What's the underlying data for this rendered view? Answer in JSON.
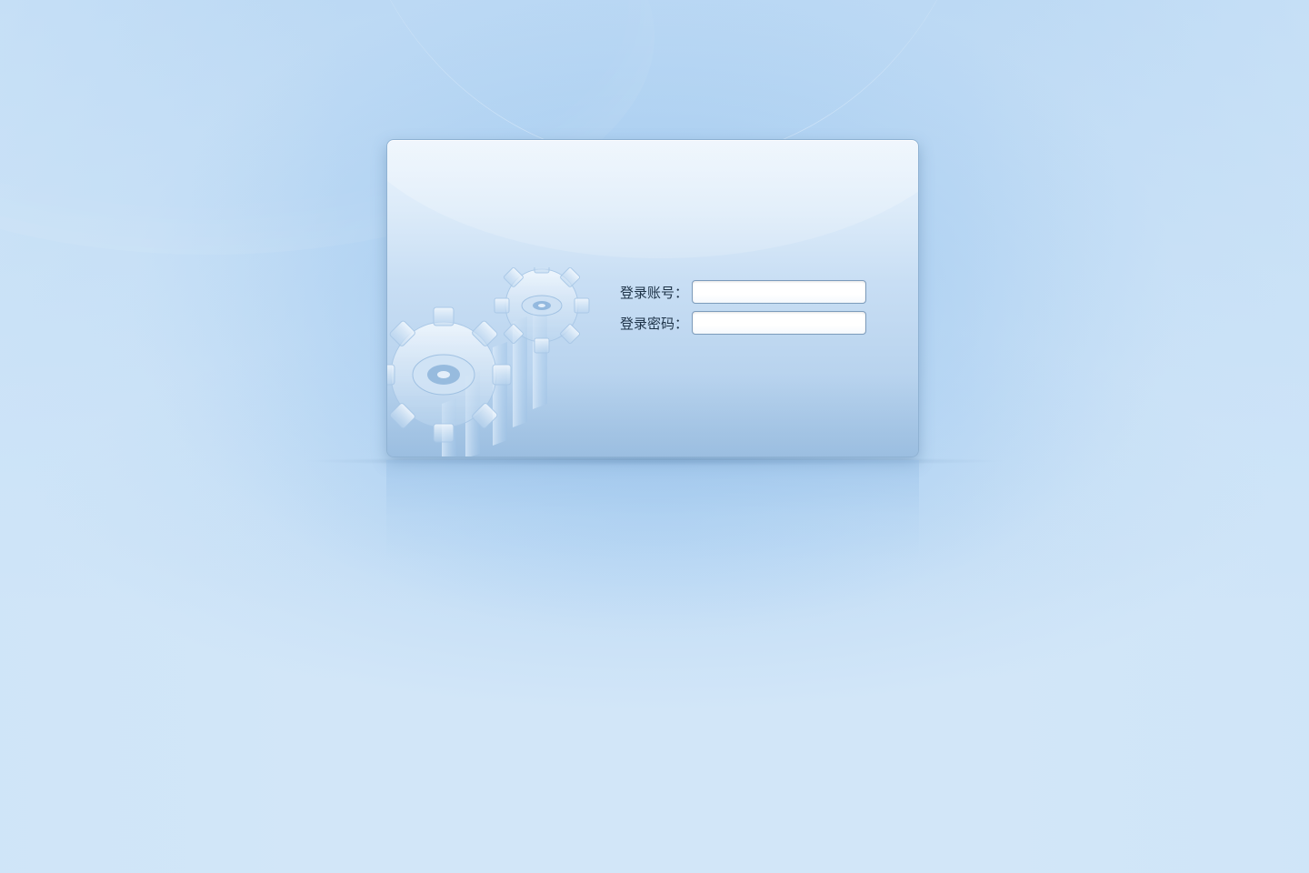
{
  "login": {
    "account_label": "登录账号：",
    "account_value": "",
    "password_label": "登录密码：",
    "password_value": ""
  },
  "colors": {
    "background": "#c8e0f6",
    "panel_top": "#eaf3fc",
    "panel_bottom": "#a9c8e6",
    "label_text": "#1e3348",
    "input_border": "#7d9cbc"
  },
  "icons": {
    "decoration": "gears-icon"
  }
}
